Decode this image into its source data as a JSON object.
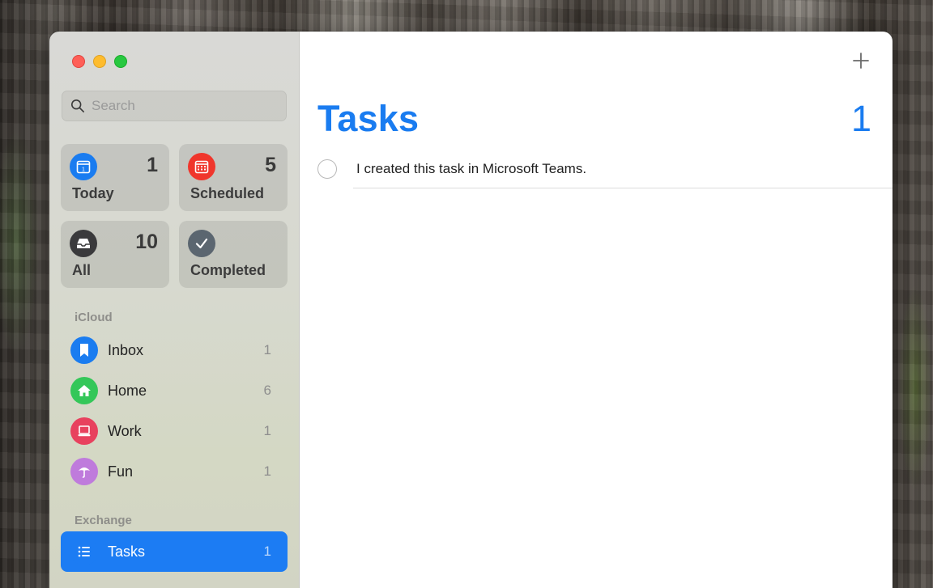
{
  "sidebar": {
    "search": {
      "placeholder": "Search"
    },
    "smart_lists": [
      {
        "label": "Today",
        "count": "1",
        "icon": "calendar-today-icon",
        "color": "#1a7cf0"
      },
      {
        "label": "Scheduled",
        "count": "5",
        "icon": "calendar-icon",
        "color": "#f0362c"
      },
      {
        "label": "All",
        "count": "10",
        "icon": "tray-icon",
        "color": "#3a3a3c"
      },
      {
        "label": "Completed",
        "count": "",
        "icon": "checkmark-icon",
        "color": "#5b6670"
      }
    ],
    "icloud": {
      "title": "iCloud",
      "lists": [
        {
          "label": "Inbox",
          "count": "1",
          "icon": "bookmark-icon",
          "color": "#1a7cf0"
        },
        {
          "label": "Home",
          "count": "6",
          "icon": "house-icon",
          "color": "#34c759"
        },
        {
          "label": "Work",
          "count": "1",
          "icon": "laptop-icon",
          "color": "#e8415e"
        },
        {
          "label": "Fun",
          "count": "1",
          "icon": "umbrella-icon",
          "color": "#bf7bdc"
        }
      ]
    },
    "exchange": {
      "title": "Exchange",
      "lists": [
        {
          "label": "Tasks",
          "count": "1",
          "icon": "list-bullet-icon",
          "color": "#1c7cf3",
          "selected": true
        }
      ]
    }
  },
  "main": {
    "title": "Tasks",
    "count": "1",
    "add_button_icon": "plus-icon",
    "tasks": [
      {
        "text": "I created this task in Microsoft Teams.",
        "completed": false
      }
    ]
  }
}
